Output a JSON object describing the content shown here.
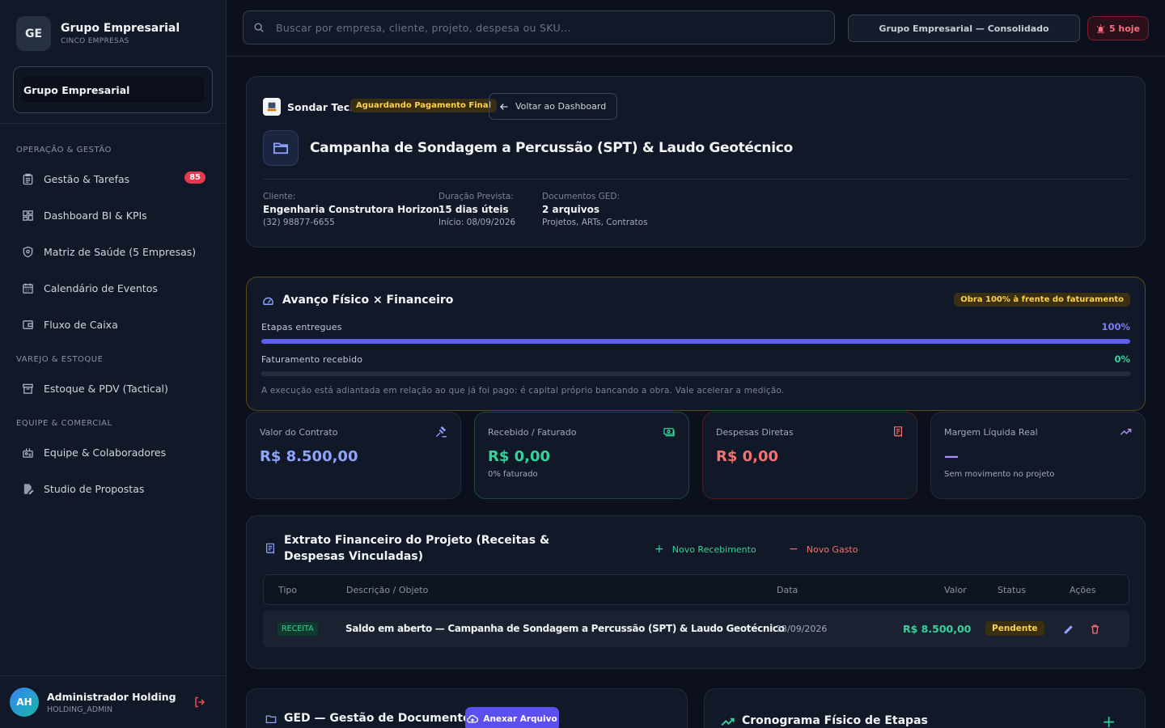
{
  "brand": {
    "initials": "GE",
    "title": "Grupo Empresarial",
    "subtitle": "CINCO EMPRESAS"
  },
  "org_selector": {
    "value": "Grupo Empresarial"
  },
  "sidebar": {
    "sections": [
      "OPERAÇÃO & GESTÃO",
      "VAREJO & ESTOQUE",
      "EQUIPE & COMERCIAL"
    ],
    "items": [
      {
        "label": "Gestão & Tarefas",
        "badge": "85"
      },
      {
        "label": "Dashboard BI & KPIs"
      },
      {
        "label": "Matriz de Saúde (5 Empresas)"
      },
      {
        "label": "Calendário de Eventos"
      },
      {
        "label": "Fluxo de Caixa"
      },
      {
        "label": "Estoque & PDV (Tactical)"
      },
      {
        "label": "Equipe & Colaboradores"
      },
      {
        "label": "Studio de Propostas"
      }
    ]
  },
  "user": {
    "initials": "AH",
    "name": "Administrador Holding",
    "role": "HOLDING_ADMIN"
  },
  "topbar": {
    "search_placeholder": "Buscar por empresa, cliente, projeto, despesa ou SKU...",
    "consolidated": "Grupo Empresarial — Consolidado",
    "notifications": "5 hoje"
  },
  "project": {
    "company": "Sondar Tech",
    "status": "Aguardando Pagamento Final",
    "back": "Voltar ao Dashboard",
    "title": "Campanha de Sondagem a Percussão (SPT) & Laudo Geotécnico",
    "client_label": "Cliente:",
    "client_name": "Engenharia Construtora Horizon",
    "client_phone": "(32) 98877-6655",
    "duration_label": "Duração Prevista:",
    "duration_value": "15 dias úteis",
    "duration_start": "Início: 08/09/2026",
    "docs_label": "Documentos GED:",
    "docs_value": "2 arquivos",
    "docs_types": "Projetos, ARTs, Contratos"
  },
  "progress": {
    "title": "Avanço Físico × Financeiro",
    "badge": "Obra 100% à frente do faturamento",
    "stages_label": "Etapas entregues",
    "stages_pct": "100%",
    "stages_value": 1.0,
    "billing_label": "Faturamento recebido",
    "billing_pct": "0%",
    "billing_value": 0.0,
    "note": "A execução está adiantada em relação ao que já foi pago: é capital próprio bancando a obra. Vale acelerar a medição."
  },
  "kpis": [
    {
      "label": "Valor do Contrato",
      "value": "R$ 8.500,00",
      "sub": ""
    },
    {
      "label": "Recebido / Faturado",
      "value": "R$ 0,00",
      "sub": "0% faturado"
    },
    {
      "label": "Despesas Diretas",
      "value": "R$ 0,00",
      "sub": ""
    },
    {
      "label": "Margem Líquida Real",
      "value": "—",
      "sub": "Sem movimento no projeto"
    }
  ],
  "colors": {
    "accent": "#5b5ff0",
    "green": "#34d399",
    "red": "#f87171",
    "purple": "#a78bfa",
    "gold": "#fcd34d"
  },
  "statement": {
    "title": "Extrato Financeiro do Projeto (Receitas & Despesas Vinculadas)",
    "new_income": "Novo Recebimento",
    "new_expense": "Novo Gasto",
    "columns": [
      "Tipo",
      "Descrição / Objeto",
      "Data",
      "Valor",
      "Status",
      "Ações"
    ],
    "rows": [
      {
        "type": "RECEITA",
        "description": "Saldo em aberto — Campanha de Sondagem a Percussão (SPT) & Laudo Geotécnico",
        "date": "23/09/2026",
        "value": "R$ 8.500,00",
        "status": "Pendente"
      }
    ]
  },
  "ged": {
    "title": "GED — Gestão de Documentos",
    "attach": "Anexar Arquivo"
  },
  "schedule": {
    "title": "Cronograma Físico de Etapas"
  }
}
